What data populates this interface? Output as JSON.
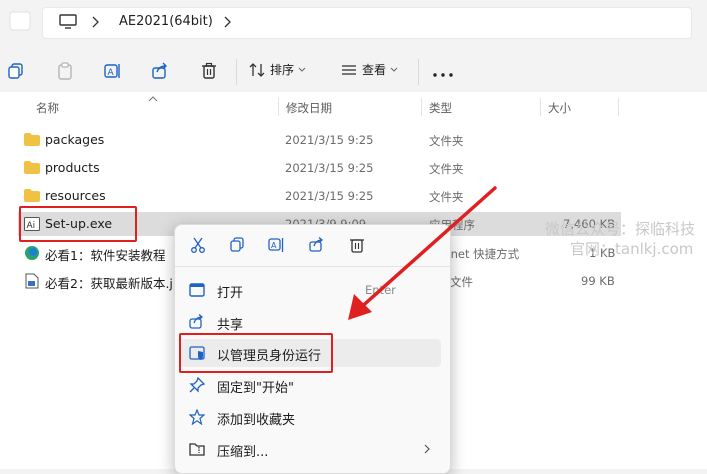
{
  "address_bar": {
    "path": "AE2021(64bit)"
  },
  "toolbar": {
    "sort_label": "排序",
    "view_label": "查看"
  },
  "columns": {
    "name": "名称",
    "modified": "修改日期",
    "type": "类型",
    "size": "大小"
  },
  "files": [
    {
      "name": "packages",
      "modified": "2021/3/15 9:25",
      "type": "文件夹",
      "size": ""
    },
    {
      "name": "products",
      "modified": "2021/3/15 9:25",
      "type": "文件夹",
      "size": ""
    },
    {
      "name": "resources",
      "modified": "2021/3/15 9:25",
      "type": "文件夹",
      "size": ""
    },
    {
      "name": "Set-up.exe",
      "modified": "2021/3/9 9:09",
      "type": "应用程序",
      "size": "7,460 KB"
    },
    {
      "name": "必看1：软件安装教程（",
      "modified": "",
      "type": "ernet 快捷方式",
      "size": "1 KB"
    },
    {
      "name": "必看2：获取最新版本.jp",
      "modified": "",
      "type": "5 文件",
      "size": "99 KB"
    }
  ],
  "context_menu": {
    "items": [
      {
        "label": "打开",
        "shortcut": "Enter"
      },
      {
        "label": "共享",
        "shortcut": ""
      },
      {
        "label": "以管理员身份运行",
        "shortcut": ""
      },
      {
        "label": "固定到\"开始\"",
        "shortcut": ""
      },
      {
        "label": "添加到收藏夹",
        "shortcut": ""
      },
      {
        "label": "压缩到...",
        "shortcut": ""
      }
    ]
  },
  "watermark": {
    "line1": "微信公众号：探临科技",
    "line2": "官网：tanlkj.com"
  },
  "colors": {
    "highlight": "#e02020",
    "folder": "#f0c244",
    "selected_row": "#dcdcdc",
    "accent": "#1e63c4"
  }
}
